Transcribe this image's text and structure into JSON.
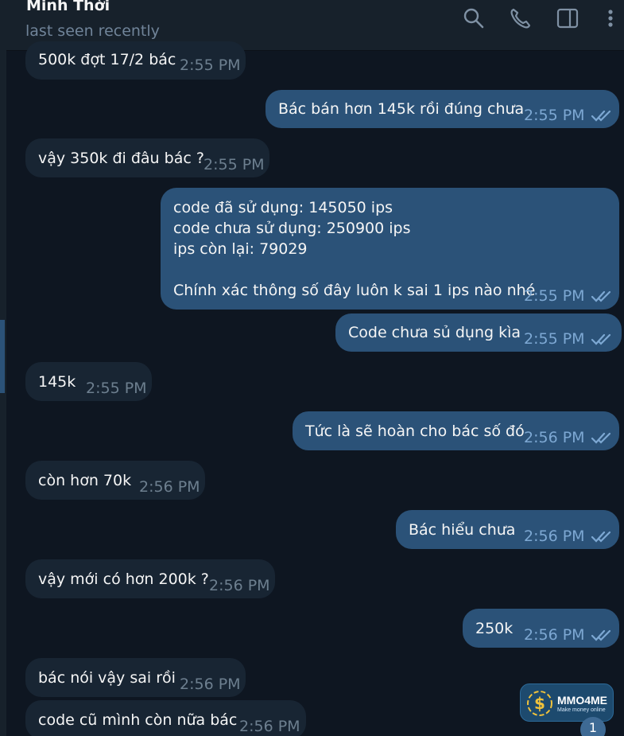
{
  "header": {
    "contact_name": "Minh Thời",
    "status": "last seen recently",
    "icons": [
      "search-icon",
      "phone-icon",
      "sidebar-toggle-icon",
      "more-vertical-icon"
    ]
  },
  "colors": {
    "background": "#0e1621",
    "incoming_bubble": "#182533",
    "outgoing_bubble": "#2b5278",
    "read_check": "#7da8d3"
  },
  "messages": [
    {
      "direction": "in",
      "text": "500k đợt 17/2 bác",
      "time": "2:55 PM"
    },
    {
      "direction": "out",
      "text": "Bác bán hơn 145k rồi đúng chưa",
      "time": "2:55 PM",
      "status": "read"
    },
    {
      "direction": "in",
      "text": "vậy 350k đi đâu bác ?",
      "time": "2:55 PM"
    },
    {
      "direction": "out",
      "text": "code đã sử dụng: 145050 ips\ncode chưa sử dụng: 250900 ips\nips còn lại: 79029\n\nChính xác thông số đây luôn k sai 1 ips nào nhé",
      "time": "2:55 PM",
      "status": "read"
    },
    {
      "direction": "out",
      "text": "Code chưa sủ dụng kìa",
      "time": "2:55 PM",
      "status": "read"
    },
    {
      "direction": "in",
      "text": "145k",
      "time": "2:55 PM"
    },
    {
      "direction": "out",
      "text": "Tức là sẽ hoàn cho bác số đó",
      "time": "2:56 PM",
      "status": "read"
    },
    {
      "direction": "in",
      "text": "còn hơn 70k",
      "time": "2:56 PM"
    },
    {
      "direction": "out",
      "text": "Bác hiểu chưa",
      "time": "2:56 PM",
      "status": "read"
    },
    {
      "direction": "in",
      "text": "vậy mới có hơn 200k ?",
      "time": "2:56 PM"
    },
    {
      "direction": "out",
      "text": "250k",
      "time": "2:56 PM",
      "status": "read"
    },
    {
      "direction": "in",
      "text": "bác nói vậy sai rồi",
      "time": "2:56 PM"
    },
    {
      "direction": "in",
      "text": "code cũ mình còn nữa bác",
      "time": "2:56 PM"
    }
  ],
  "watermark": {
    "brand": "MMO4ME",
    "tagline": "Make money online"
  },
  "unread_badge": "1"
}
